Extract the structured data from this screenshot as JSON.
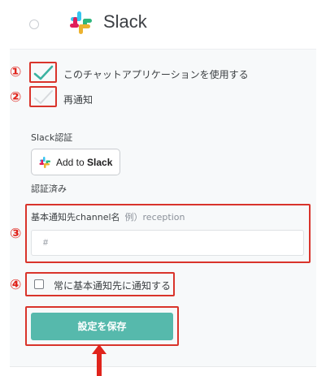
{
  "app": {
    "name": "Slack"
  },
  "annotations": {
    "n1": "①",
    "n2": "②",
    "n3": "③",
    "n4": "④"
  },
  "settings": {
    "use_app_label": "このチャットアプリケーションを使用する",
    "use_app_checked": true,
    "renotify_label": "再通知",
    "renotify_checked": false,
    "auth_title": "Slack認証",
    "add_to_slack": {
      "prefix": "Add to ",
      "bold": "Slack"
    },
    "auth_status": "認証済み",
    "channel_label": "基本通知先channel名",
    "channel_example": "例）reception",
    "channel_value": "#",
    "always_notify_label": "常に基本通知先に通知する",
    "always_notify_checked": false,
    "save_label": "設定を保存"
  },
  "colors": {
    "accent": "#56b9ac",
    "annotation_red": "#d9342b"
  }
}
